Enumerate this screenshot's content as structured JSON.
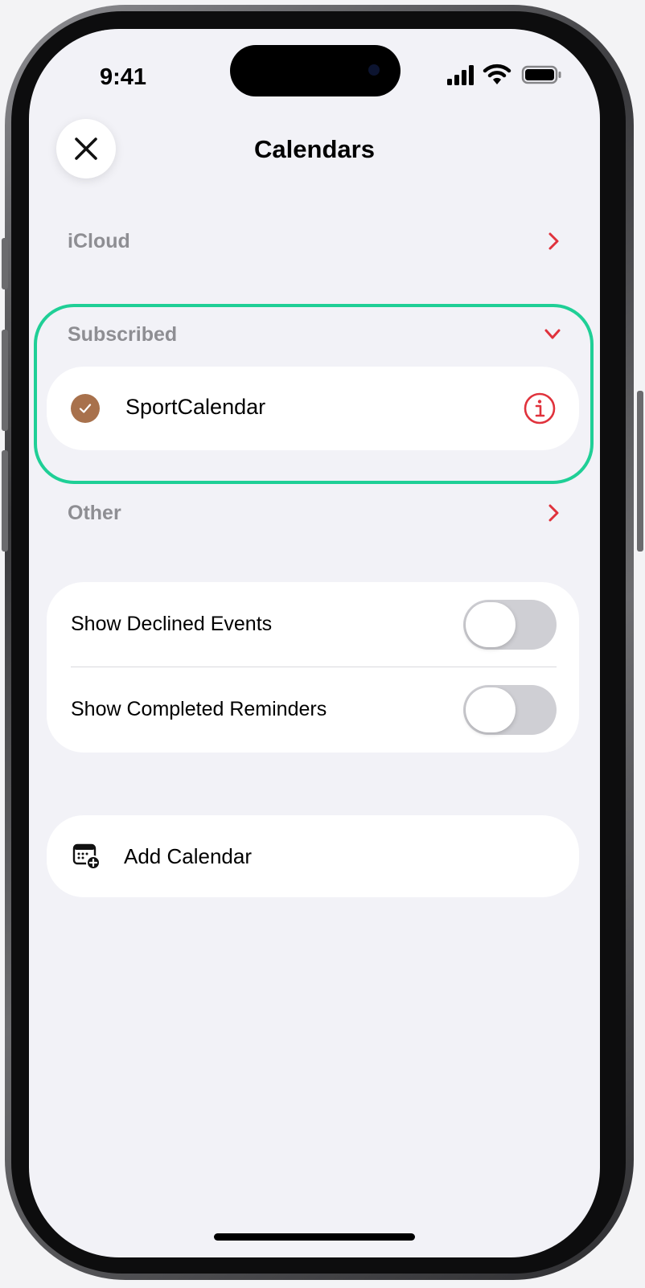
{
  "status_bar": {
    "time": "9:41",
    "icons": [
      "cellular-signal-icon",
      "wifi-icon",
      "battery-icon"
    ]
  },
  "header": {
    "title": "Calendars",
    "close_icon": "close-icon"
  },
  "sections": {
    "icloud": {
      "label": "iCloud",
      "chevron": "chevron-right-icon"
    },
    "subscribed": {
      "label": "Subscribed",
      "chevron": "chevron-down-icon",
      "expanded": true
    },
    "other": {
      "label": "Other",
      "chevron": "chevron-right-icon"
    }
  },
  "subscribed_calendars": [
    {
      "name": "SportCalendar",
      "color": "#a8714c",
      "checked": true,
      "info_icon": "info-icon"
    }
  ],
  "toggles": [
    {
      "label": "Show Declined Events",
      "on": false
    },
    {
      "label": "Show Completed Reminders",
      "on": false
    }
  ],
  "add_calendar": {
    "label": "Add Calendar",
    "icon": "calendar-add-icon"
  },
  "colors": {
    "accent": "#e0323c",
    "highlight": "#1fcf96",
    "section_label": "#8e8e93",
    "background": "#f2f2f7"
  }
}
